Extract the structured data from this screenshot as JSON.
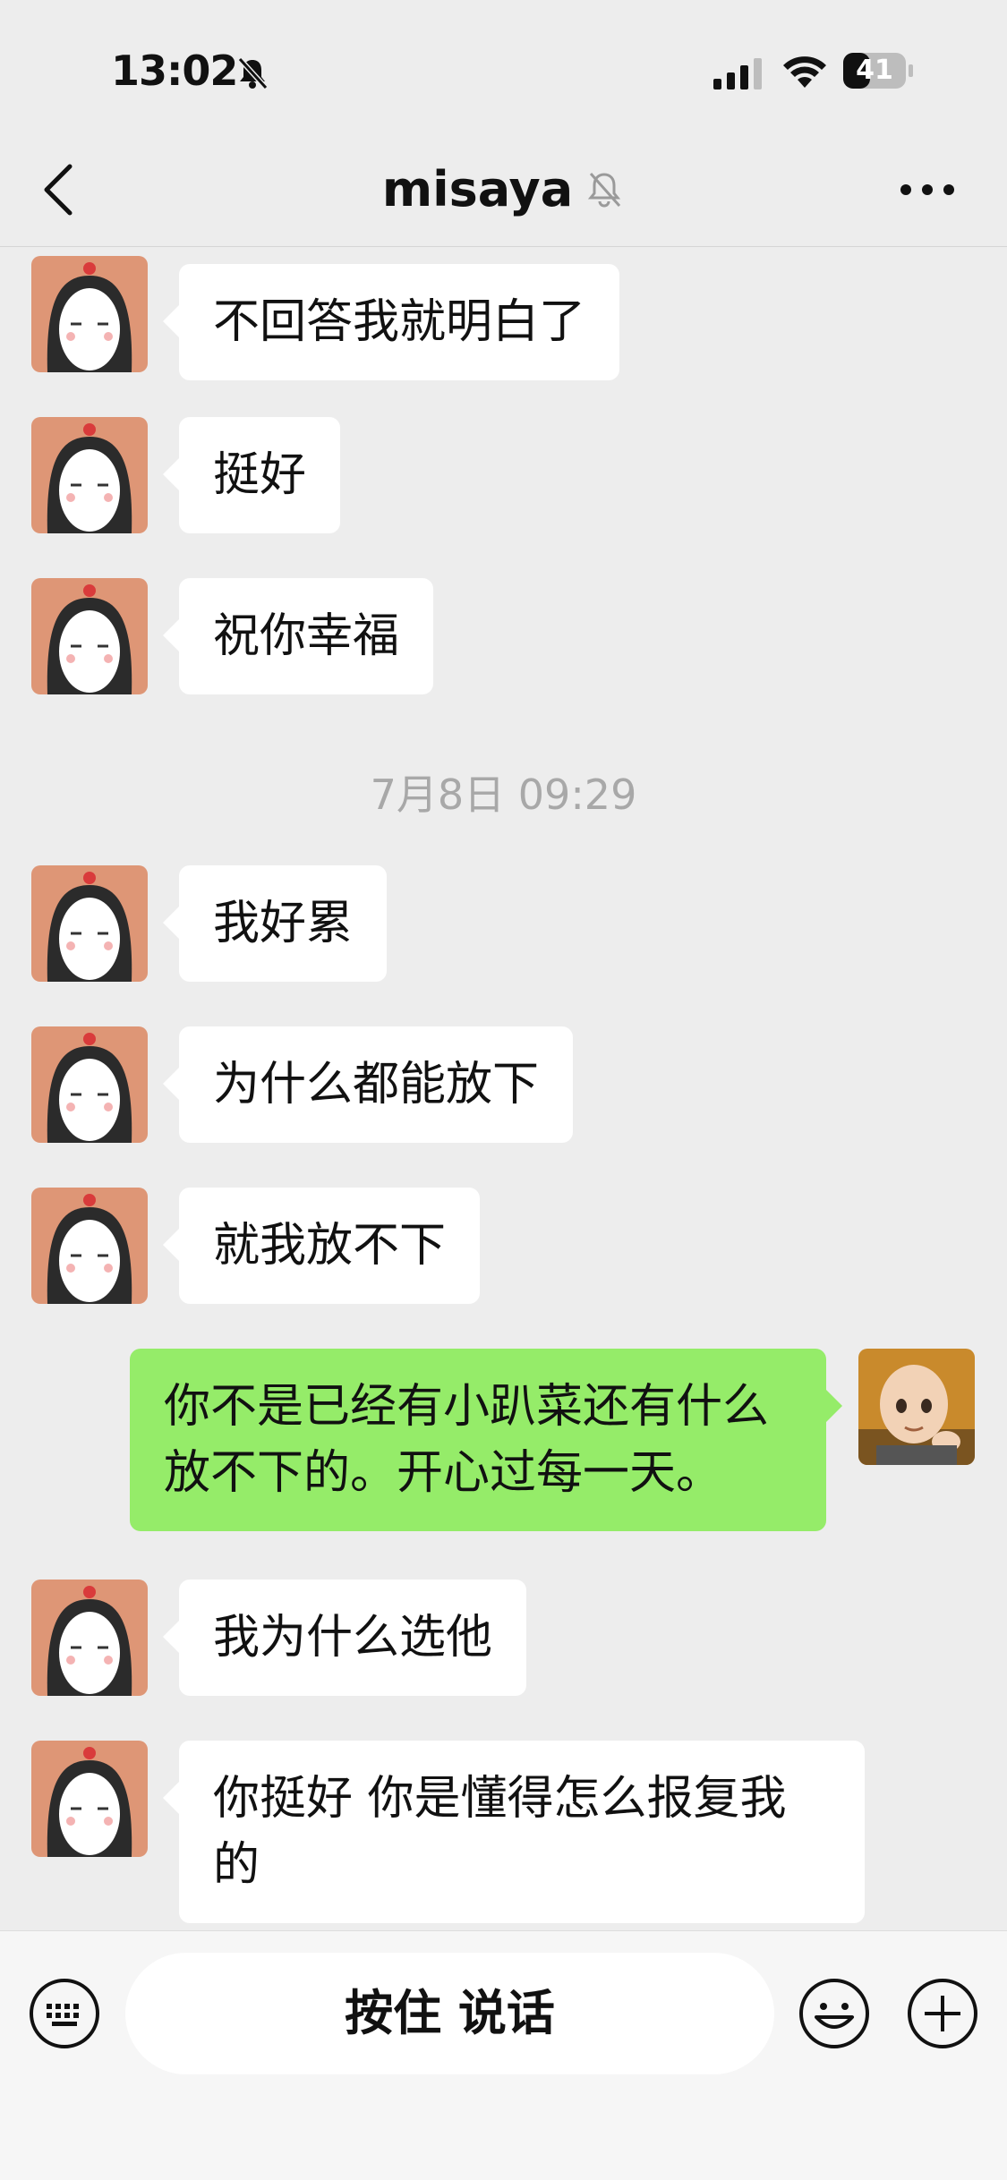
{
  "status_bar": {
    "time": "13:02",
    "battery": "41",
    "icons": [
      "bell-slash-icon",
      "signal-icon",
      "wifi-icon",
      "battery-icon"
    ]
  },
  "nav": {
    "title": "misaya",
    "icons": [
      "back-chevron-icon",
      "mute-bell-icon",
      "more-dots-icon"
    ]
  },
  "chat": {
    "messages": [
      {
        "side": "in",
        "text": "不回答我就明白了"
      },
      {
        "side": "in",
        "text": "挺好"
      },
      {
        "side": "in",
        "text": "祝你幸福"
      },
      {
        "type": "timestamp",
        "text": "7月8日 09:29"
      },
      {
        "side": "in",
        "text": "我好累"
      },
      {
        "side": "in",
        "text": "为什么都能放下"
      },
      {
        "side": "in",
        "text": "就我放不下"
      },
      {
        "side": "out",
        "text": "你不是已经有小趴菜还有什么放不下的。开心过每一天。"
      },
      {
        "side": "in",
        "text": "我为什么选他"
      },
      {
        "side": "in",
        "text": "你挺好 你是懂得怎么报复我的"
      }
    ]
  },
  "input_bar": {
    "hold_to_talk_label": "按住 说话",
    "icons": [
      "keyboard-icon",
      "emoji-icon",
      "plus-icon"
    ]
  },
  "colors": {
    "background": "#ededed",
    "incoming_bubble": "#ffffff",
    "outgoing_bubble": "#95ec69",
    "timestamp_text": "#a8a8a8"
  }
}
